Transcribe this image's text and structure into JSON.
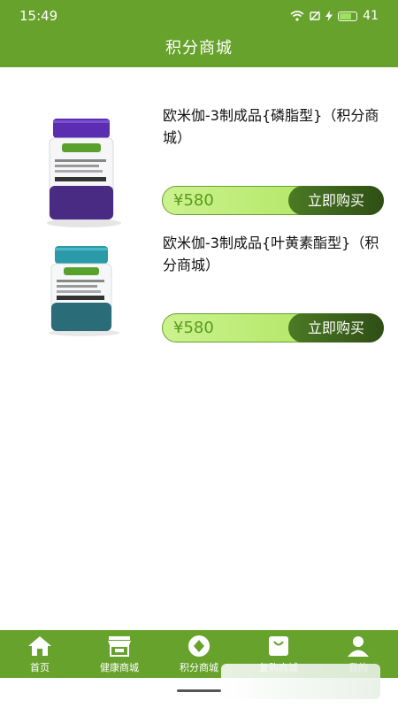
{
  "status_bar": {
    "time": "15:49",
    "battery": "41"
  },
  "header": {
    "title": "积分商城"
  },
  "products": [
    {
      "name": "欧米伽-3制成品{磷脂型}（积分商城）",
      "price": "¥580",
      "buy_label": "立即购买",
      "cap_color": "#5b2db0",
      "label_color": "#4a2b84"
    },
    {
      "name": "欧米伽-3制成品{叶黄素酯型}（积分商城）",
      "price": "¥580",
      "buy_label": "立即购买",
      "cap_color": "#2a9aa8",
      "label_color": "#2a6c78"
    }
  ],
  "bottom_nav": [
    {
      "label": "首页",
      "icon": "home-icon"
    },
    {
      "label": "健康商城",
      "icon": "store-icon"
    },
    {
      "label": "积分商城",
      "icon": "points-icon"
    },
    {
      "label": "复购商城",
      "icon": "bag-icon"
    },
    {
      "label": "我的",
      "icon": "user-icon"
    }
  ],
  "colors": {
    "brand": "#67a22c",
    "price_text": "#5a9a1c",
    "buy_button": "#3b5f1b"
  }
}
